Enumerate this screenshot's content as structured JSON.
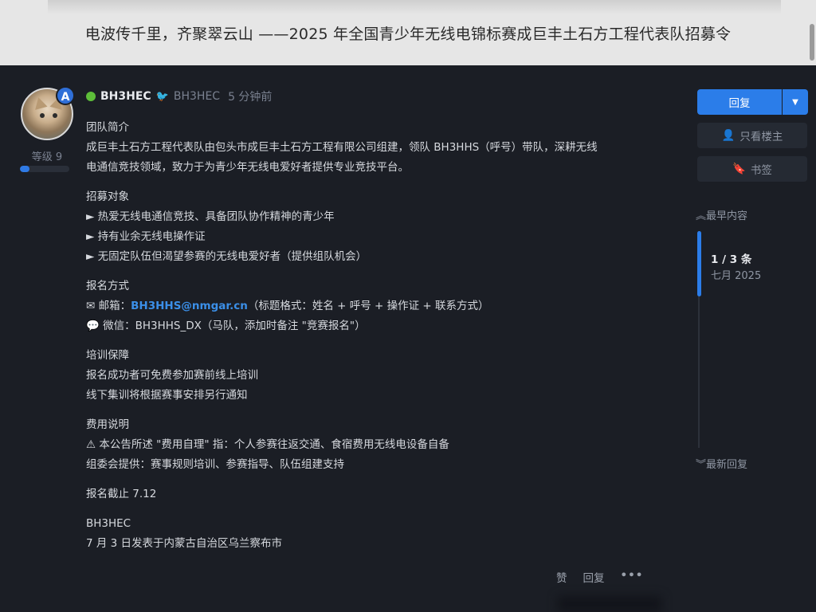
{
  "topic": {
    "title": "电波传千里，齐聚翠云山 ——2025 年全国青少年无线电锦标赛成巨丰土石方工程代表队招募令"
  },
  "author": {
    "avatar_badge": "A",
    "level_label": "等级 9",
    "level_progress": 0.2,
    "username": "BH3HEC",
    "handle": "BH3HEC",
    "time": "5 分钟前",
    "online_color": "#5dbd39"
  },
  "post": {
    "sections": [
      {
        "heading": "团队简介",
        "lines": [
          "成巨丰土石方工程代表队由包头市成巨丰土石方工程有限公司组建，领队 BH3HHS（呼号）带队，深耕无线",
          "电通信竞技领域，致力于为青少年无线电爱好者提供专业竞技平台。"
        ]
      },
      {
        "heading": "招募对象",
        "lines": [
          "► 热爱无线电通信竞技、具备团队协作精神的青少年",
          "► 持有业余无线电操作证",
          "► 无固定队伍但渴望参赛的无线电爱好者（提供组队机会）"
        ]
      },
      {
        "heading": "报名方式",
        "email_prefix": "✉ 邮箱：",
        "email": "BH3HHS@nmgar.cn",
        "email_suffix": "（标题格式：姓名 + 呼号 + 操作证 + 联系方式）",
        "wechat": "💬 微信：BH3HHS_DX（马队，添加时备注 \"竞赛报名\"）"
      },
      {
        "heading": "培训保障",
        "lines": [
          "报名成功者可免费参加赛前线上培训",
          "线下集训将根据赛事安排另行通知"
        ]
      },
      {
        "heading": "费用说明",
        "lines": [
          "⚠ 本公告所述 \"费用自理\" 指：个人参赛往返交通、食宿费用无线电设备自备",
          "组委会提供：赛事规则培训、参赛指导、队伍组建支持"
        ]
      }
    ],
    "deadline": "报名截止 7.12",
    "signature": "BH3HEC",
    "posted_from": "7 月 3 日发表于内蒙古自治区乌兰察布市"
  },
  "actions": {
    "like": "赞",
    "reply": "回复",
    "more": "•••"
  },
  "sidebar": {
    "reply_label": "回复",
    "op_only_label": "只看楼主",
    "bookmark_label": "书签",
    "earliest_label": "最早内容",
    "latest_label": "最新回复",
    "position": "1 / 3 条",
    "date": "七月 2025",
    "accent_color": "#2b7de9"
  }
}
